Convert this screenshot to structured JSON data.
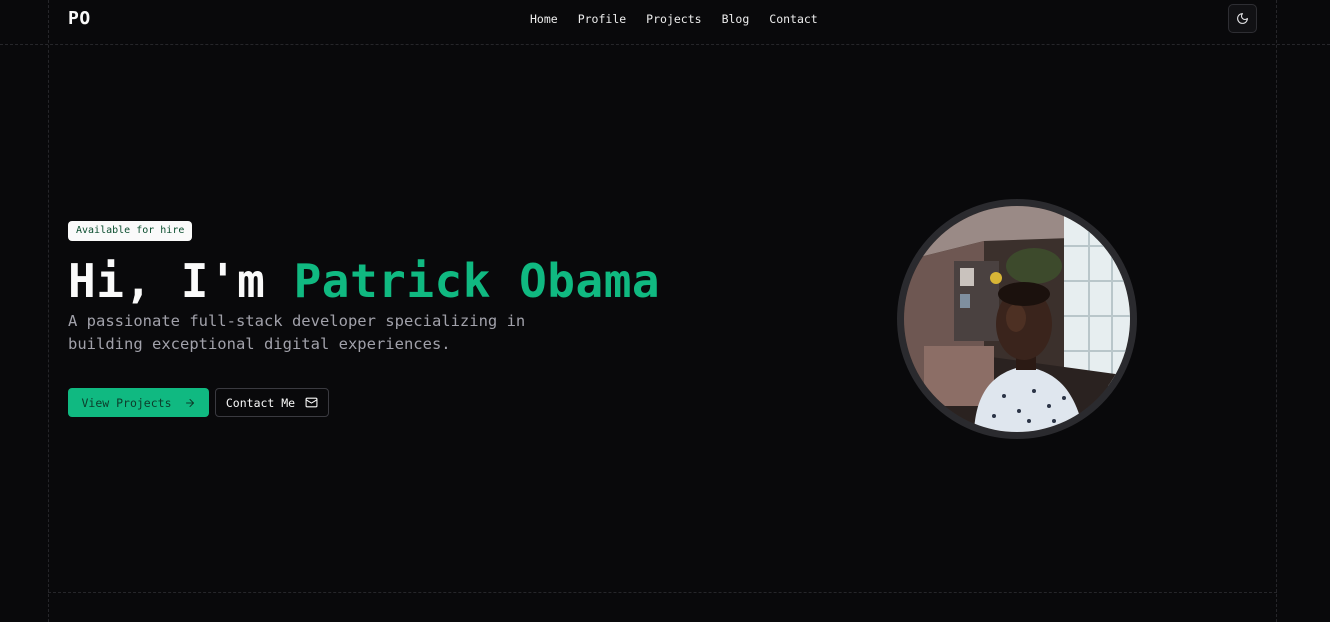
{
  "header": {
    "logo": "PO",
    "nav": [
      "Home",
      "Profile",
      "Projects",
      "Blog",
      "Contact"
    ],
    "theme_toggle_icon": "moon-icon"
  },
  "hero": {
    "badge": "Available for hire",
    "greeting": "Hi, I'm ",
    "name": "Patrick Obama",
    "subtitle": "A passionate full-stack developer specializing in building exceptional digital experiences.",
    "primary_button": "View Projects",
    "primary_button_icon": "arrow-right-icon",
    "secondary_button": "Contact Me",
    "secondary_button_icon": "mail-icon"
  },
  "colors": {
    "background": "#09090b",
    "accent": "#10b981",
    "text": "#fafafa",
    "muted": "#a1a1aa"
  }
}
